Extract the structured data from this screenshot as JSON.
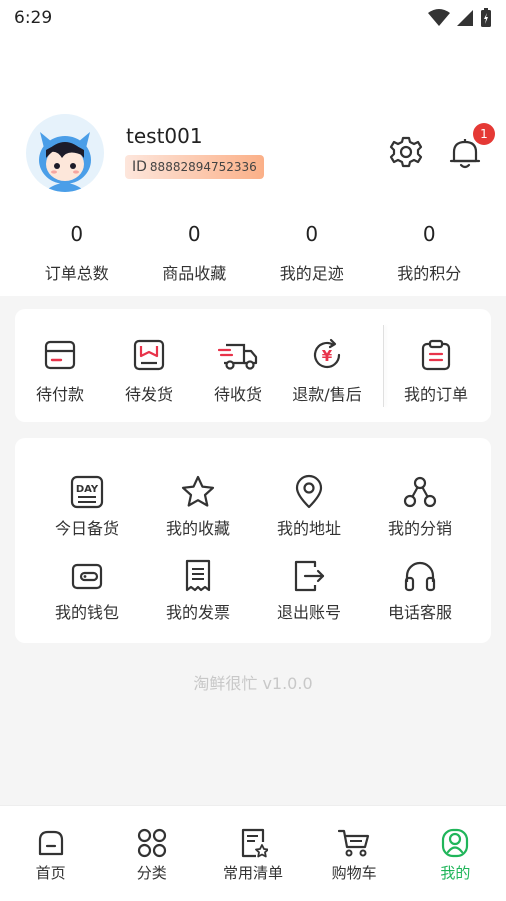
{
  "status_bar": {
    "time": "6:29",
    "icons": [
      "wifi-icon",
      "signal-icon",
      "battery-icon"
    ]
  },
  "profile": {
    "username": "test001",
    "id_label": "ID",
    "id_number": "88882894752336",
    "notification_count": "1"
  },
  "stats": [
    {
      "value": "0",
      "label": "订单总数"
    },
    {
      "value": "0",
      "label": "商品收藏"
    },
    {
      "value": "0",
      "label": "我的足迹"
    },
    {
      "value": "0",
      "label": "我的积分"
    }
  ],
  "orders": [
    {
      "label": "待付款",
      "icon": "card-icon"
    },
    {
      "label": "待发货",
      "icon": "box-icon"
    },
    {
      "label": "待收货",
      "icon": "truck-icon"
    },
    {
      "label": "退款/售后",
      "icon": "refund-icon"
    },
    {
      "label": "我的订单",
      "icon": "clipboard-icon"
    }
  ],
  "services": [
    {
      "label": "今日备货",
      "icon": "day-icon"
    },
    {
      "label": "我的收藏",
      "icon": "star-icon"
    },
    {
      "label": "我的地址",
      "icon": "location-icon"
    },
    {
      "label": "我的分销",
      "icon": "share-icon"
    },
    {
      "label": "我的钱包",
      "icon": "wallet-icon"
    },
    {
      "label": "我的发票",
      "icon": "invoice-icon"
    },
    {
      "label": "退出账号",
      "icon": "logout-icon"
    },
    {
      "label": "电话客服",
      "icon": "headset-icon"
    }
  ],
  "version_text": "淘鲜很忙 v1.0.0",
  "tabs": [
    {
      "label": "首页",
      "icon": "home-icon"
    },
    {
      "label": "分类",
      "icon": "category-icon"
    },
    {
      "label": "常用清单",
      "icon": "list-icon"
    },
    {
      "label": "购物车",
      "icon": "cart-icon"
    },
    {
      "label": "我的",
      "icon": "user-icon",
      "active": true
    }
  ],
  "colors": {
    "accent": "#20b55a",
    "badge": "#e53935",
    "alert_red": "#e8334a",
    "id_badge": "#fbb088"
  }
}
